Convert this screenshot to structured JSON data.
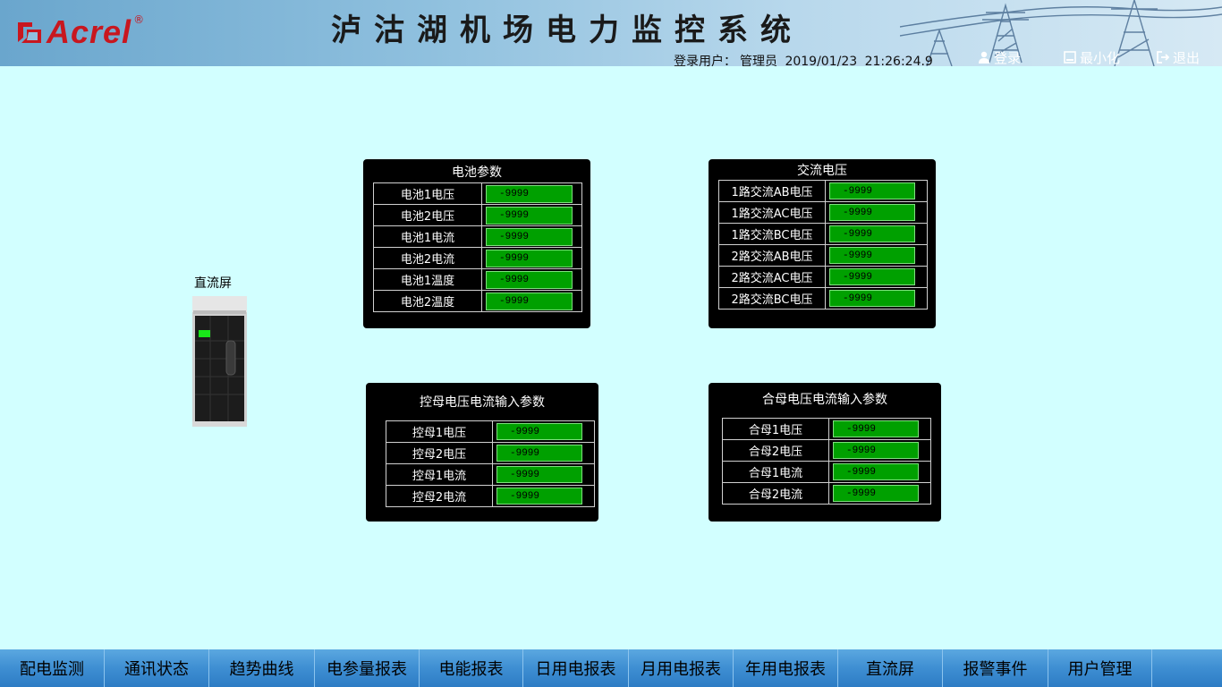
{
  "header": {
    "logo_text": "Acrel",
    "logo_reg": "®",
    "title": "泸沽湖机场电力监控系统",
    "login_user_label": "登录用户：",
    "user_name": "管理员",
    "date": "2019/01/23",
    "time": "21:26:24.9",
    "login_label": "登录",
    "minimize_label": "最小化",
    "exit_label": "退出"
  },
  "cabinet": {
    "label": "直流屏"
  },
  "panels": {
    "battery": {
      "title": "电池参数",
      "rows": [
        {
          "label": "电池1电压",
          "value": "-9999"
        },
        {
          "label": "电池2电压",
          "value": "-9999"
        },
        {
          "label": "电池1电流",
          "value": "-9999"
        },
        {
          "label": "电池2电流",
          "value": "-9999"
        },
        {
          "label": "电池1温度",
          "value": "-9999"
        },
        {
          "label": "电池2温度",
          "value": "-9999"
        }
      ]
    },
    "ac": {
      "title": "交流电压",
      "rows": [
        {
          "label": "1路交流AB电压",
          "value": "-9999"
        },
        {
          "label": "1路交流AC电压",
          "value": "-9999"
        },
        {
          "label": "1路交流BC电压",
          "value": "-9999"
        },
        {
          "label": "2路交流AB电压",
          "value": "-9999"
        },
        {
          "label": "2路交流AC电压",
          "value": "-9999"
        },
        {
          "label": "2路交流BC电压",
          "value": "-9999"
        }
      ]
    },
    "control_bus": {
      "title": "控母电压电流输入参数",
      "rows": [
        {
          "label": "控母1电压",
          "value": "-9999"
        },
        {
          "label": "控母2电压",
          "value": "-9999"
        },
        {
          "label": "控母1电流",
          "value": "-9999"
        },
        {
          "label": "控母2电流",
          "value": "-9999"
        }
      ]
    },
    "closing_bus": {
      "title": "合母电压电流输入参数",
      "rows": [
        {
          "label": "合母1电压",
          "value": "-9999"
        },
        {
          "label": "合母2电压",
          "value": "-9999"
        },
        {
          "label": "合母1电流",
          "value": "-9999"
        },
        {
          "label": "合母2电流",
          "value": "-9999"
        }
      ]
    }
  },
  "nav": [
    "配电监测",
    "通讯状态",
    "趋势曲线",
    "电参量报表",
    "电能报表",
    "日用电报表",
    "月用电报表",
    "年用电报表",
    "直流屏",
    "报警事件",
    "用户管理"
  ],
  "colors": {
    "background": "#d2ffff",
    "value_box": "#00a000",
    "panel": "#000000",
    "navbar": "#3e8ed2",
    "logo": "#c8171f"
  }
}
